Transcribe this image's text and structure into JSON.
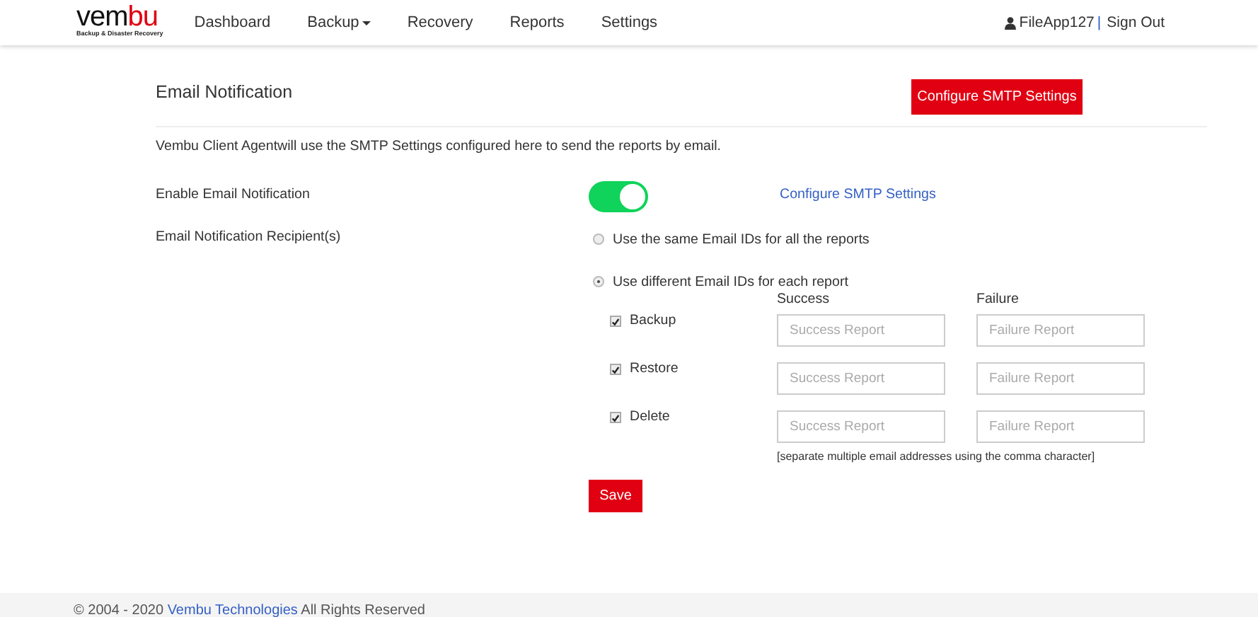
{
  "navbar": {
    "logo": {
      "main": "vem",
      "accent": "bu",
      "tagline": "Backup & Disaster Recovery"
    },
    "items": [
      {
        "label": "Dashboard",
        "dropdown": false
      },
      {
        "label": "Backup",
        "dropdown": true
      },
      {
        "label": "Recovery",
        "dropdown": false
      },
      {
        "label": "Reports",
        "dropdown": false
      },
      {
        "label": "Settings",
        "dropdown": false
      }
    ],
    "user": "FileApp127",
    "separator": "|",
    "sign_out": "Sign Out"
  },
  "page": {
    "title": "Email Notification",
    "configure_button": "Configure SMTP Settings",
    "description": "Vembu Client Agentwill use the SMTP Settings configured here to send the reports by email.",
    "enable_label": "Enable Email Notification",
    "enable_on": true,
    "configure_link": "Configure SMTP Settings",
    "recipients_label": "Email Notification Recipient(s)",
    "options": [
      {
        "label": "Use the same Email IDs for all the reports",
        "selected": false
      },
      {
        "label": "Use different Email IDs for each report",
        "selected": true
      }
    ],
    "columns": [
      "Success",
      "Failure"
    ],
    "reports": [
      {
        "label": "Backup",
        "checked": true,
        "success_placeholder": "Success Report",
        "failure_placeholder": "Failure Report"
      },
      {
        "label": "Restore",
        "checked": true,
        "success_placeholder": "Success Report",
        "failure_placeholder": "Failure Report"
      },
      {
        "label": "Delete",
        "checked": true,
        "success_placeholder": "Success Report",
        "failure_placeholder": "Failure Report"
      }
    ],
    "hint": "[separate multiple email addresses using the comma character]",
    "save_button": "Save"
  },
  "footer": {
    "prefix": "© 2004 - 2020 ",
    "link": "Vembu Technologies",
    "suffix": " All Rights Reserved"
  }
}
